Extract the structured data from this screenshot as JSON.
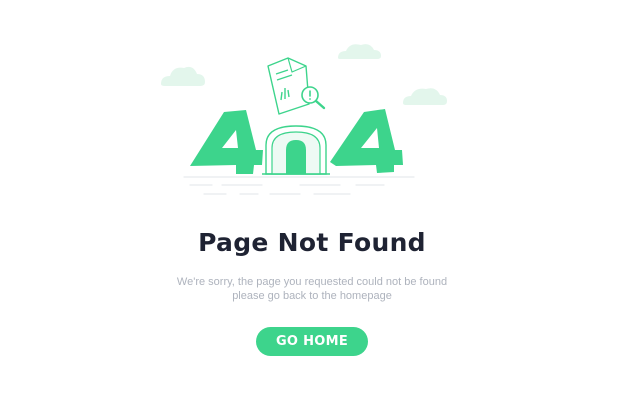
{
  "error": {
    "title": "Page Not Found",
    "message_line1": "We're sorry, the page you requested could not be found",
    "message_line2": "please go back to the homepage",
    "button_label": "GO HOME"
  },
  "illustration": {
    "code_text": "404",
    "icons": [
      "cloud-icon",
      "document-icon",
      "magnifier-icon",
      "archway-icon"
    ]
  },
  "colors": {
    "accent": "#3dd48c",
    "accent_light": "#e6f8ef",
    "title": "#1f2333",
    "muted_text": "#aeb3bd",
    "cloud": "#e3f6ec"
  }
}
